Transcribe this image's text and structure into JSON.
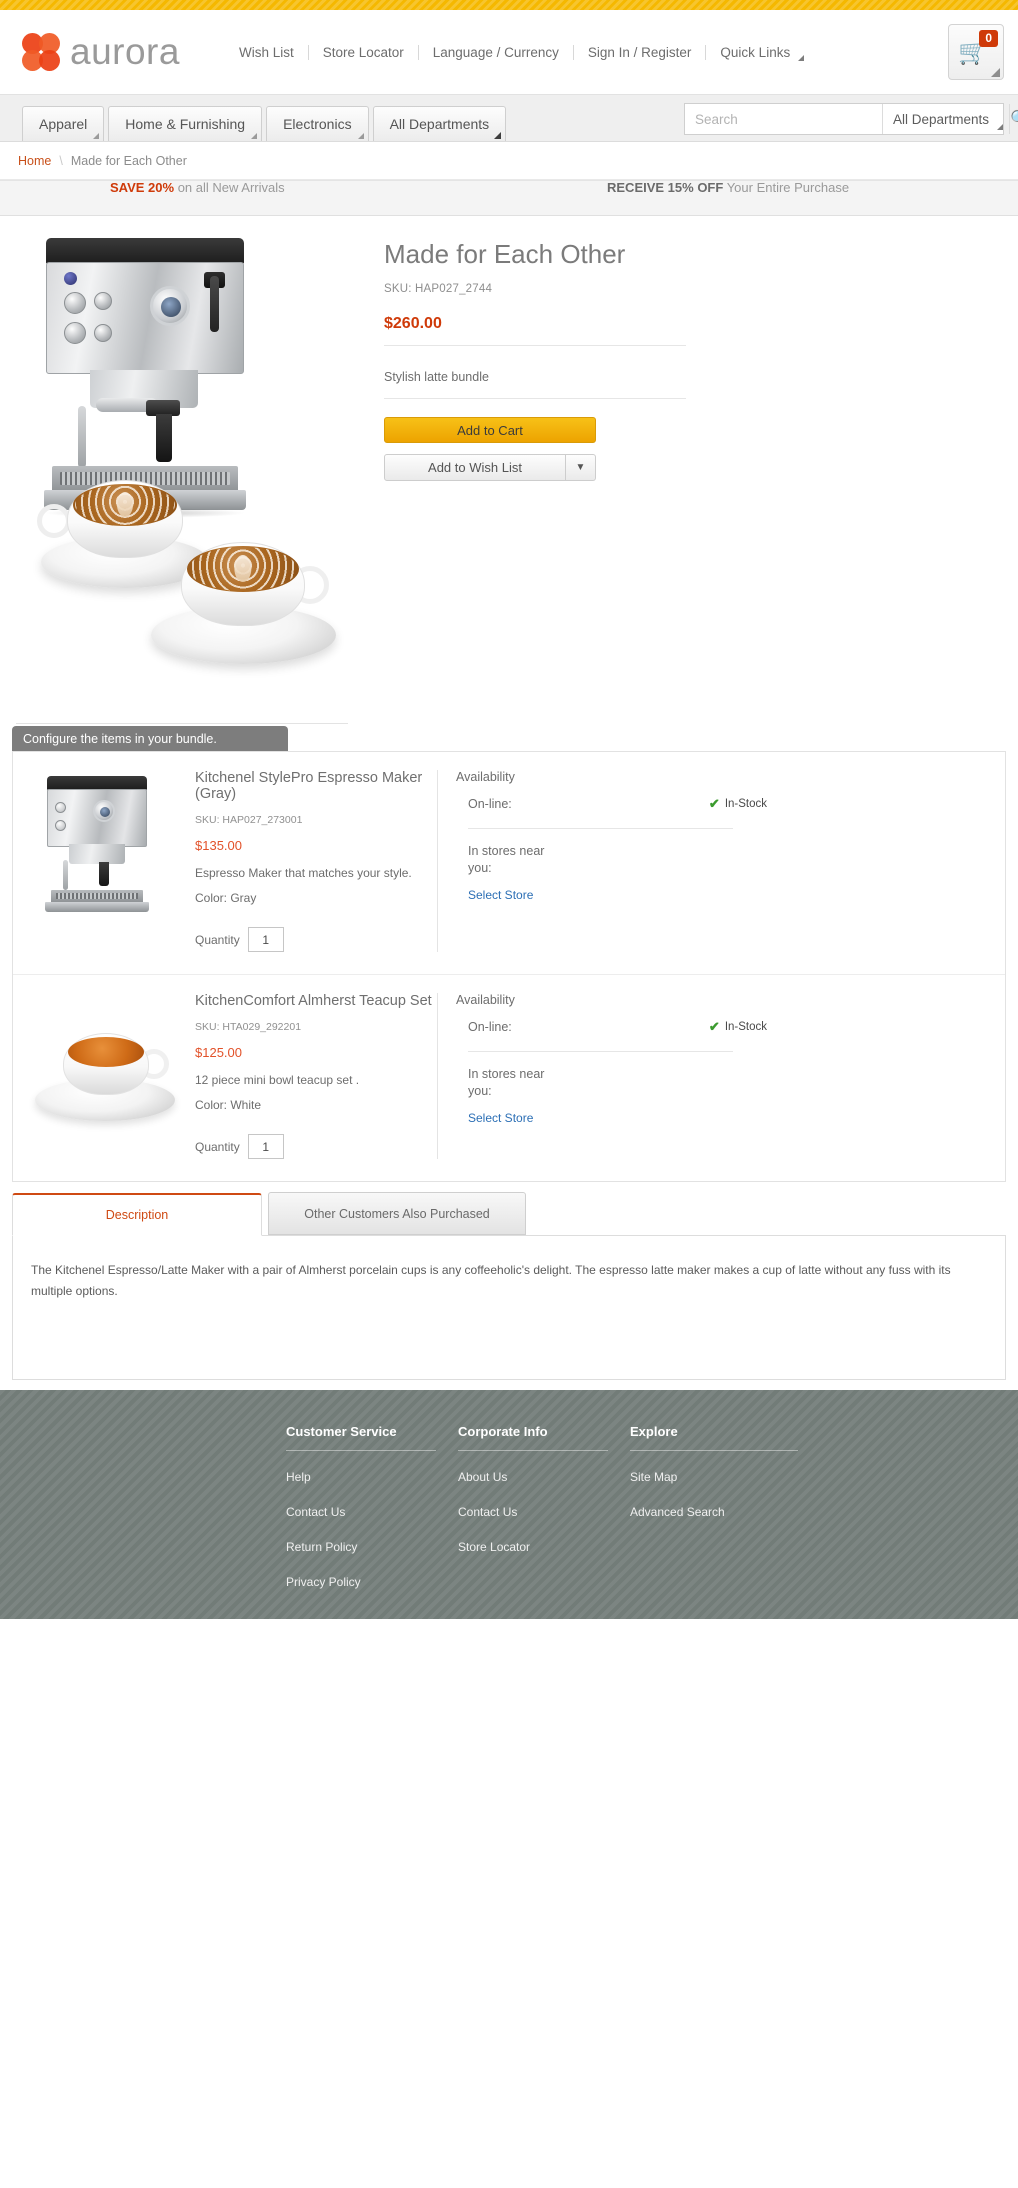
{
  "brand": {
    "name": "aurora"
  },
  "utility_nav": [
    {
      "label": "Wish List"
    },
    {
      "label": "Store Locator"
    },
    {
      "label": "Language / Currency"
    },
    {
      "label": "Sign In / Register"
    },
    {
      "label": "Quick Links"
    }
  ],
  "cart": {
    "count": "0"
  },
  "departments": [
    {
      "label": "Apparel"
    },
    {
      "label": "Home & Furnishing"
    },
    {
      "label": "Electronics"
    },
    {
      "label": "All Departments"
    }
  ],
  "search": {
    "placeholder": "Search",
    "value": "",
    "scope": "All Departments"
  },
  "breadcrumb": {
    "home": "Home",
    "separator": "\\",
    "current": "Made for Each Other"
  },
  "promo": {
    "left_strong": "SAVE 20%",
    "left_rest": " on all New Arrivals",
    "right_strong": "RECEIVE 15% OFF",
    "right_rest": " Your Entire Purchase"
  },
  "product": {
    "title": "Made for Each Other",
    "sku": "SKU: HAP027_2744",
    "price": "$260.00",
    "description": "Stylish latte bundle",
    "add_to_cart": "Add to Cart",
    "add_to_wish_list": "Add to Wish List",
    "wish_caret": "▼"
  },
  "bundle": {
    "header": "Configure the items in your bundle.",
    "availability_title": "Availability",
    "online_label": "On-line:",
    "stock_status": "In-Stock",
    "stores_label": "In stores near you:",
    "select_store": "Select Store",
    "quantity_label": "Quantity",
    "items": [
      {
        "title": "Kitchenel StylePro Espresso Maker (Gray)",
        "sku": "SKU: HAP027_273001",
        "price": "$135.00",
        "blurb": "Espresso Maker that matches your style.",
        "color": "Color: Gray",
        "quantity": "1"
      },
      {
        "title": "KitchenComfort Almherst Teacup Set",
        "sku": "SKU: HTA029_292201",
        "price": "$125.00",
        "blurb": "12 piece mini bowl teacup set .",
        "color": "Color: White",
        "quantity": "1"
      }
    ]
  },
  "tabs": {
    "active": {
      "label": "Description"
    },
    "idle": {
      "label": "Other Customers Also Purchased"
    },
    "description_text": "The Kitchenel Espresso/Latte Maker with a pair of Almherst porcelain cups is any coffeeholic's delight. The espresso latte maker makes a cup of latte without any fuss with its multiple options."
  },
  "footer": {
    "columns": [
      {
        "heading": "Customer Service",
        "links": [
          {
            "label": "Help"
          },
          {
            "label": "Contact Us"
          },
          {
            "label": "Return Policy"
          },
          {
            "label": "Privacy Policy"
          }
        ]
      },
      {
        "heading": "Corporate Info",
        "links": [
          {
            "label": "About Us"
          },
          {
            "label": "Contact Us"
          },
          {
            "label": "Store Locator"
          }
        ]
      },
      {
        "heading": "Explore",
        "links": [
          {
            "label": "Site Map"
          },
          {
            "label": "Advanced Search"
          }
        ]
      }
    ]
  },
  "colors": {
    "accent_orange": "#cf3a09",
    "brand_red": "#ec3f13",
    "cart_yellow": "#f1ab00",
    "top_strip": "#f5b800",
    "in_stock_green": "#3c9b2f",
    "link_blue": "#2c6fb5",
    "footer_gray": "#76807c"
  }
}
